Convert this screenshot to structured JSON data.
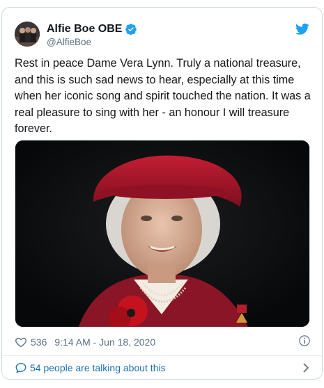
{
  "tweet": {
    "display_name": "Alfie Boe OBE",
    "handle": "@AlfieBoe",
    "text": "Rest in peace Dame Vera Lynn. Truly a national treasure, and this is such sad news to hear, especially at this time when her iconic song and spirit touched the nation. It was a real pleasure to sing with her - an honour I will treasure forever.",
    "likes": "536",
    "timestamp": "9:14 AM - Jun 18, 2020"
  },
  "footer": {
    "talking_label": "54 people are talking about this"
  },
  "icons": {
    "verified": "verified-badge-icon",
    "platform": "twitter-bird-icon",
    "like": "heart-icon",
    "info": "info-icon",
    "conversation": "speech-bubble-icon",
    "expand": "chevron-right-icon"
  },
  "colors": {
    "brand_blue": "#1da1f2",
    "link_blue": "#1b6fb5",
    "secondary_text": "#5b7083",
    "border": "#cfd9de",
    "beret_red": "#b3142a"
  }
}
